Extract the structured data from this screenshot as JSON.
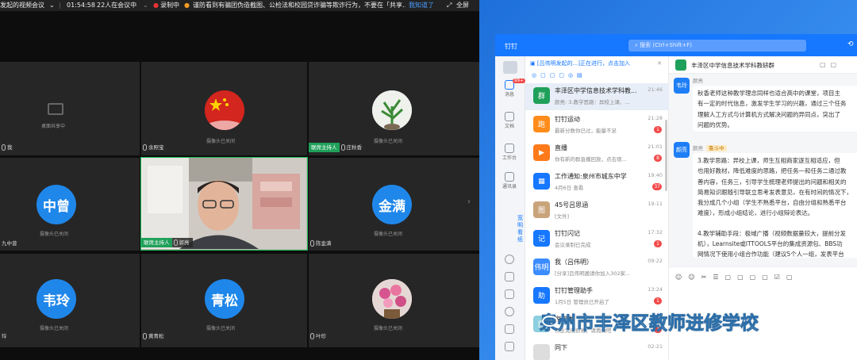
{
  "meeting": {
    "topbar": {
      "meeting_title": "发起的视频会议",
      "time": "01:54:58",
      "participants": "22人在会议中",
      "recording": "录制中",
      "notice": "谨防看到有骗团伪造截图、公检法和校园贷诈骗等欺诈行为，不要在「共享…",
      "notice_link": "我知道了",
      "fullscreen": "全屏"
    },
    "tiles": [
      {
        "type": "blank",
        "label": "",
        "tag": "我",
        "host": false,
        "cam": "桌面共享中"
      },
      {
        "type": "photo",
        "photo": "flag",
        "label": "摄像头已关闭",
        "tag": "余照宝",
        "host": false
      },
      {
        "type": "photo",
        "photo": "plant",
        "label": "摄像头已关闭",
        "tag": "庄秋香",
        "host": true
      },
      {
        "type": "avatar",
        "avatar": "中曾",
        "label": "摄像头已关闭",
        "tag": "九中曾",
        "host": false
      },
      {
        "type": "video",
        "label": "",
        "tag": "郭亮",
        "host": true
      },
      {
        "type": "avatar",
        "avatar": "金满",
        "label": "摄像头已关闭",
        "tag": "陈金满",
        "host": false
      },
      {
        "type": "avatar",
        "avatar": "韦玲",
        "label": "摄像头已关闭",
        "tag": "玲",
        "host": false
      },
      {
        "type": "avatar",
        "avatar": "青松",
        "label": "摄像头已关闭",
        "tag": "黄青松",
        "host": false
      },
      {
        "type": "photo",
        "photo": "flower",
        "label": "摄像头已关闭",
        "tag": "叶珍",
        "host": false
      }
    ],
    "host_label": "联席主持人"
  },
  "dingtalk": {
    "title_left": "钉钉",
    "search_placeholder": "搜索 (Ctrl+Shift+F)",
    "side": [
      {
        "label": "消息",
        "badge": "99+"
      },
      {
        "label": "文档"
      },
      {
        "label": "工作台"
      },
      {
        "label": "通讯录"
      }
    ],
    "side_vertical": "宽 明 看 纸 ",
    "list_banner": "[吕伟明发起的...]正在进行，点击加入",
    "list": [
      {
        "title": "丰泽区中学信息技术学科教...",
        "sub": "颜亮: 3.教学思路：异校上课、...",
        "time": "21:46",
        "badge": "",
        "color": "#1fa05a",
        "icon": "群"
      },
      {
        "title": "钉钉运动",
        "sub": "最新分数你已过，能量不足",
        "time": "21:28",
        "badge": "1",
        "color": "#ff8c1a",
        "icon": "跑"
      },
      {
        "title": "直播",
        "sub": "你有新的群直播回放，点击观...",
        "time": "21:01",
        "badge": "8",
        "color": "#ff7a1a",
        "icon": "▶"
      },
      {
        "title": "工作通知:泉州市城东中学",
        "sub": "4月6日 查看",
        "time": "19:40",
        "badge": "37",
        "color": "#1677ff",
        "icon": "▦"
      },
      {
        "title": "45号吕思涵",
        "sub": "[文件]",
        "time": "19:11",
        "badge": "",
        "color": "#c9a37a",
        "icon": "图"
      },
      {
        "title": "钉钉闪记",
        "sub": "会议录制已完成",
        "time": "17:32",
        "badge": "1",
        "color": "#1677ff",
        "icon": "记"
      },
      {
        "title": "我（吕伟明）",
        "sub": "[分享]吕伟明邀请你加入302家...",
        "time": "09:22",
        "badge": "",
        "color": "#3b8cff",
        "icon": "伟明"
      },
      {
        "title": "钉钉管理助手",
        "sub": "1月5日 管理员已开启了",
        "time": "13:24",
        "badge": "1",
        "color": "#1677ff",
        "icon": "助"
      },
      {
        "title": "家校本",
        "sub": "作业完成很难，请再做吧",
        "time": "",
        "badge": "7",
        "color": "#8ccfe0",
        "icon": "图"
      },
      {
        "title": "同下",
        "sub": "",
        "time": "02:21",
        "badge": "",
        "color": "#ddd",
        "icon": ""
      }
    ],
    "chat": {
      "title": "丰泽区中学信息技术学科教研群",
      "msg1_sender": "颜亮",
      "msg1_name": "韦玲",
      "msg1_text": [
        "秋香老师这种教学理念同样也适合高中的课堂，项目主",
        "有一定的时代信息，激发学生学习的兴趣，通过三个任务",
        "理解人工方式与计算机方式解决问题的异同点，突出了",
        "问题的优势。"
      ],
      "msg2_name": "颜亮",
      "msg2_badge": "鲁斗中",
      "msg2_text": [
        "3.教学思路：异校上课，师生互相商家逐互相适应，但",
        "也用好教材，降低难度的思路，把任务一和任务二通过教",
        "善内容，任务三，引导学生梳理老师提出的问题和相关的",
        "简易知识跟随引导联立思考发表意见，在有时间的情况下，",
        "我分成几个小组（学生不熟悉平台，自由分组和熟悉平台",
        "难度），形成小组结论，进行小组辩论表达。",
        "",
        "4.教学辅助手段：极域广播（视频数据量较大，提前分发",
        "机），Learnsite或ITTOOLS平台的集成资源包、BBS功",
        "网情况下使用小组合作功能（建议5个人一组，发表平台"
      ]
    }
  },
  "watermark": "泉州市丰泽区教师进修学校"
}
